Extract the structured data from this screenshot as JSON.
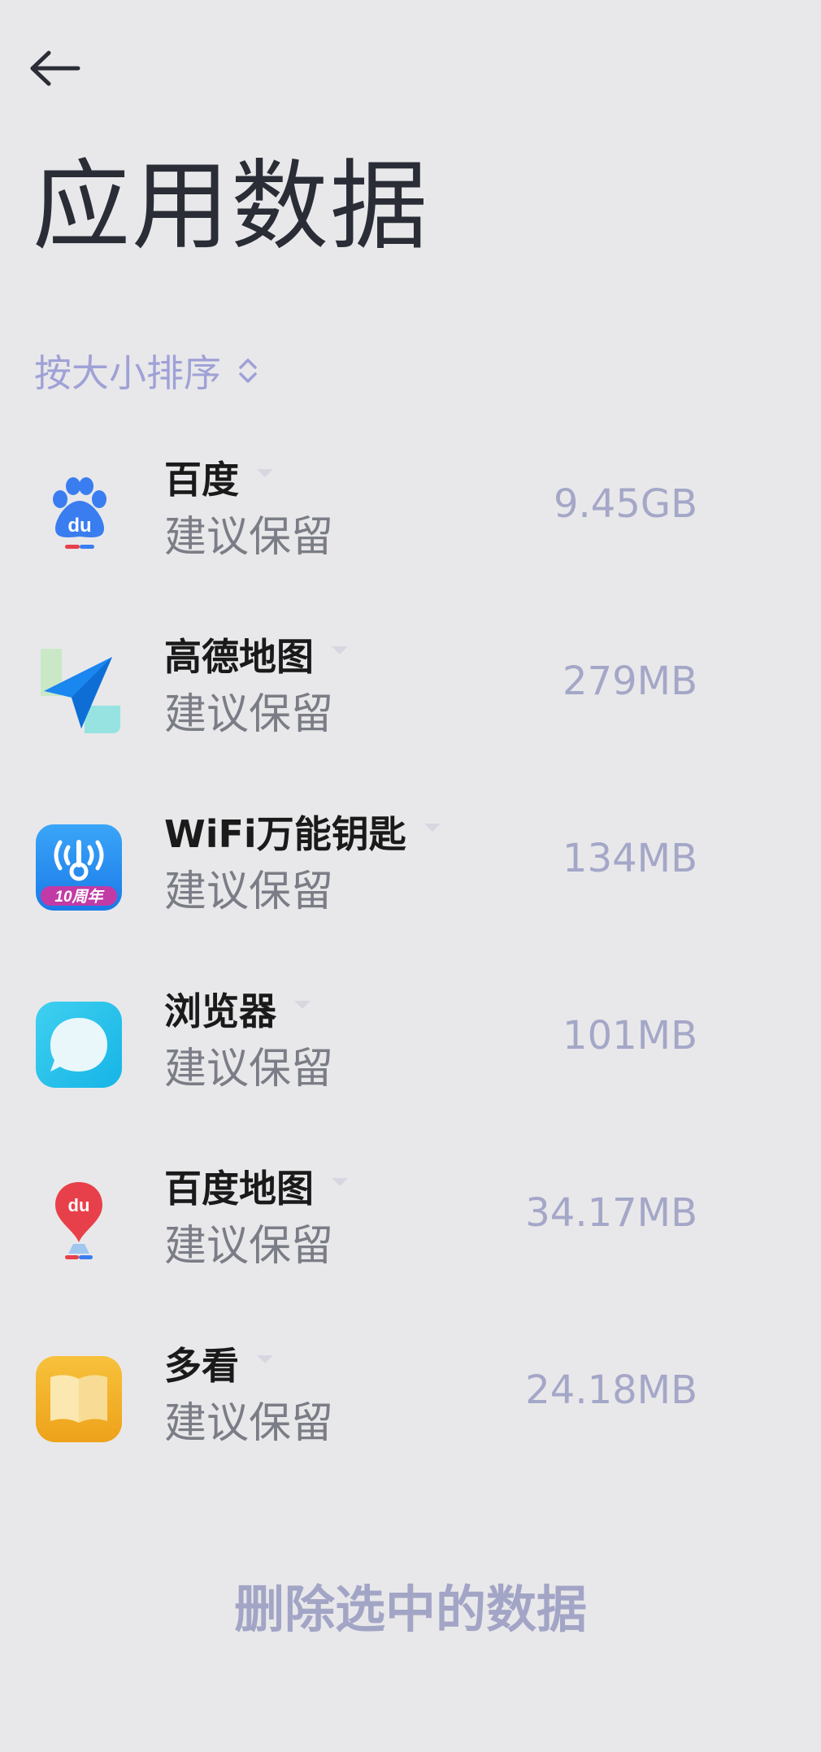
{
  "header": {
    "back_icon": "arrow-left-icon",
    "title": "应用数据"
  },
  "sort": {
    "label": "按大小排序",
    "icon": "sort-updown-icon"
  },
  "apps": [
    {
      "name": "百度",
      "status": "建议保留",
      "size": "9.45GB",
      "icon": "baidu-paw-icon"
    },
    {
      "name": "高德地图",
      "status": "建议保留",
      "size": "279MB",
      "icon": "amap-plane-icon"
    },
    {
      "name": "WiFi万能钥匙",
      "status": "建议保留",
      "size": "134MB",
      "icon": "wifi-key-icon"
    },
    {
      "name": "浏览器",
      "status": "建议保留",
      "size": "101MB",
      "icon": "browser-bubble-icon"
    },
    {
      "name": "百度地图",
      "status": "建议保留",
      "size": "34.17MB",
      "icon": "baidu-map-pin-icon"
    },
    {
      "name": "多看",
      "status": "建议保留",
      "size": "24.18MB",
      "icon": "duokan-book-icon"
    }
  ],
  "wifi_badge": "10周年",
  "baidu_mark": "du",
  "delete_label": "删除选中的数据",
  "colors": {
    "background": "#e8e8ea",
    "accent": "#9fa1d6",
    "size_text": "#a5a7c8"
  }
}
